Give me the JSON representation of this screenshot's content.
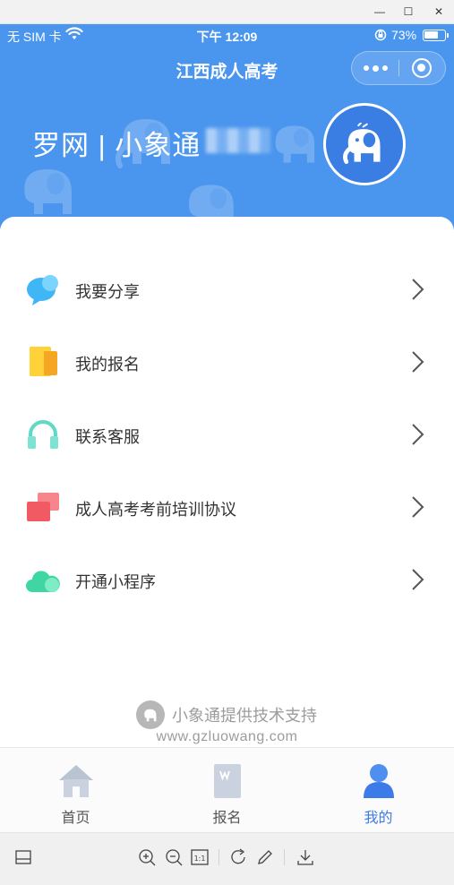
{
  "window": {
    "minimize_glyph": "—",
    "maximize_glyph": "☐",
    "close_glyph": "✕"
  },
  "status_bar": {
    "carrier": "无 SIM 卡",
    "time": "下午 12:09",
    "battery": "73%",
    "battery_level": 0.73
  },
  "nav": {
    "title": "江西成人高考"
  },
  "banner": {
    "text": "罗网 | 小象通"
  },
  "menu": [
    {
      "label": "我要分享",
      "icon": "chat-bubble-icon"
    },
    {
      "label": "我的报名",
      "icon": "document-icon"
    },
    {
      "label": "联系客服",
      "icon": "headset-icon"
    },
    {
      "label": "成人高考考前培训协议",
      "icon": "cards-icon"
    },
    {
      "label": "开通小程序",
      "icon": "cloud-icon"
    }
  ],
  "footer": {
    "brand": "小象通提供技术支持",
    "url": "www.gzluowang.com"
  },
  "tabbar": [
    {
      "label": "首页",
      "icon": "home-icon",
      "active": false
    },
    {
      "label": "报名",
      "icon": "form-icon",
      "active": false
    },
    {
      "label": "我的",
      "icon": "user-icon",
      "active": true
    }
  ],
  "colors": {
    "header_blue": "#4a95ee",
    "active_tab": "#3d7be8",
    "text": "#333333"
  },
  "viewer_toolbar": {
    "actual_size_label": "1:1"
  }
}
